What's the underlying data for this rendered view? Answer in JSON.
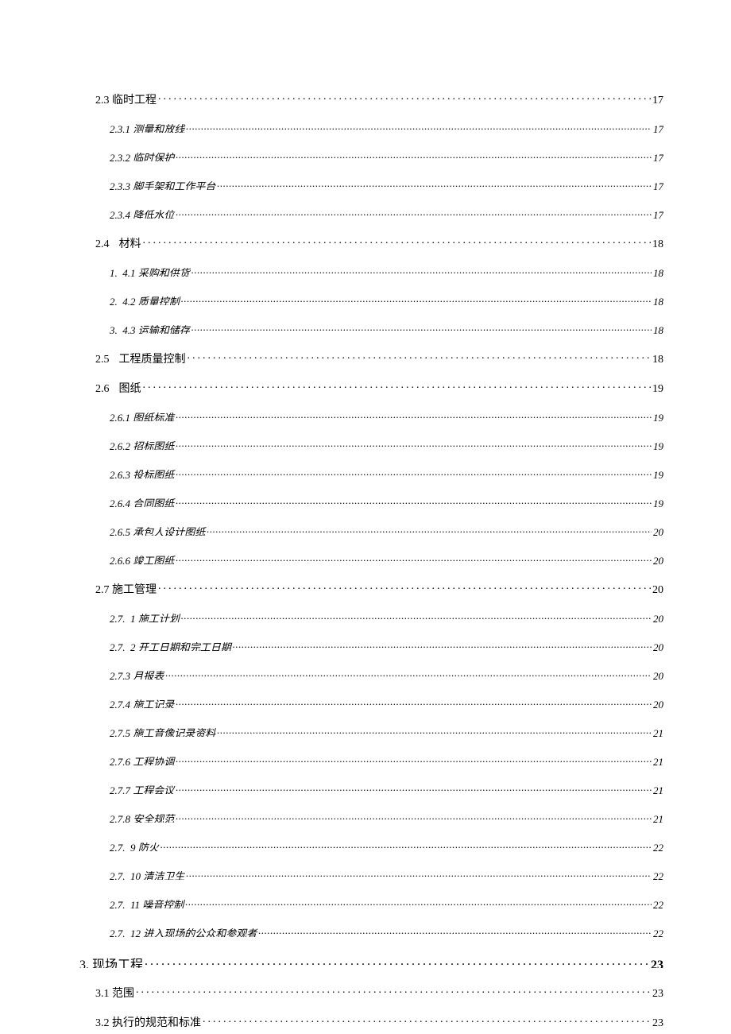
{
  "toc": [
    {
      "level": 2,
      "title": "2.3 临时工程",
      "page": "17",
      "style": "loose"
    },
    {
      "level": 3,
      "title": "2.3.1 测量和放线",
      "page": "17",
      "style": "tight"
    },
    {
      "level": 3,
      "title": "2.3.2 临时保护",
      "page": "17",
      "style": "tight"
    },
    {
      "level": 3,
      "title": "2.3.3 脚手架和工作平台",
      "page": "17",
      "style": "tight"
    },
    {
      "level": 3,
      "title": "2.3.4 降低水位",
      "page": "17",
      "style": "tight"
    },
    {
      "level": 2,
      "title": "2.4",
      "gap": true,
      "title2": "材料",
      "page": "18",
      "style": "loose"
    },
    {
      "level": 3,
      "prefix": "1.",
      "title": "4.1 采购和供货",
      "page": "18",
      "style": "tight"
    },
    {
      "level": 3,
      "prefix": "2.",
      "title": "4.2 质量控制",
      "page": "18",
      "style": "tight"
    },
    {
      "level": 3,
      "prefix": "3.",
      "title": "4.3 运输和储存",
      "page": "18",
      "style": "tight"
    },
    {
      "level": 2,
      "title": "2.5",
      "gap": true,
      "title2": "工程质量控制",
      "page": "18",
      "style": "loose"
    },
    {
      "level": 2,
      "title": "2.6",
      "gap": true,
      "title2": "图纸",
      "page": "19",
      "style": "loose"
    },
    {
      "level": 3,
      "title": "2.6.1 图纸标准",
      "page": "19",
      "style": "tight"
    },
    {
      "level": 3,
      "title": "2.6.2 招标图纸",
      "page": "19",
      "style": "tight"
    },
    {
      "level": 3,
      "title": "2.6.3 投标图纸",
      "page": "19",
      "style": "tight"
    },
    {
      "level": 3,
      "title": "2.6.4 合同图纸",
      "page": "19",
      "style": "tight"
    },
    {
      "level": 3,
      "title": "2.6.5 承包人设计图纸",
      "page": "20",
      "style": "tight"
    },
    {
      "level": 3,
      "title": "2.6.6 竣工图纸",
      "page": "20",
      "style": "tight"
    },
    {
      "level": 2,
      "title": "2.7 施工管理",
      "page": "20",
      "style": "loose"
    },
    {
      "level": 3,
      "prefix": "2.7.",
      "title": "1 施工计划",
      "page": "20",
      "style": "tight"
    },
    {
      "level": 3,
      "prefix": "2.7.",
      "title": "2 开工日期和完工日期",
      "page": "20",
      "style": "tight"
    },
    {
      "level": 3,
      "title": "2.7.3 月报表",
      "page": "20",
      "style": "tight"
    },
    {
      "level": 3,
      "title": "2.7.4 施工记录",
      "page": "20",
      "style": "tight"
    },
    {
      "level": 3,
      "title": "2.7.5 施工音像记录资料",
      "page": "21",
      "style": "tight"
    },
    {
      "level": 3,
      "title": "2.7.6 工程协调",
      "page": "21",
      "style": "tight"
    },
    {
      "level": 3,
      "title": "2.7.7 工程会议",
      "page": "21",
      "style": "tight"
    },
    {
      "level": 3,
      "title": "2.7.8 安全规范",
      "page": "21",
      "style": "tight"
    },
    {
      "level": 3,
      "prefix": "2.7.",
      "title": "9 防火",
      "page": "22",
      "style": "tight"
    },
    {
      "level": 3,
      "prefix": "2.7.",
      "title": "10 清洁卫生",
      "page": "22",
      "style": "tight"
    },
    {
      "level": 3,
      "prefix": "2.7.",
      "title": "11 噪音控制",
      "page": "22",
      "style": "tight"
    },
    {
      "level": 3,
      "prefix": "2.7.",
      "title": "12 进入现场的公众和参观者",
      "page": "22",
      "style": "tight"
    },
    {
      "level": 1,
      "title": "3. 现场工程",
      "page": "23",
      "style": "loose"
    },
    {
      "level": 2,
      "title": "3.1 范围",
      "page": "23",
      "style": "loose"
    },
    {
      "level": 2,
      "title": "3.2 执行的规范和标准",
      "page": "23",
      "style": "loose"
    }
  ]
}
